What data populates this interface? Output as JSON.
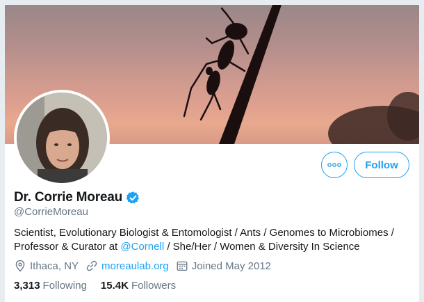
{
  "profile": {
    "name": "Dr. Corrie Moreau",
    "handle": "@CorrieMoreau",
    "verified": true,
    "bio_part1": "Scientist, Evolutionary Biologist & Entomologist / Ants / Genomes to Microbiomes / Professor & Curator at ",
    "bio_mention": "@Cornell",
    "bio_part2": " / She/Her / Women & Diversity In Science",
    "location": "Ithaca, NY",
    "website": "moreaulab.org",
    "joined": "Joined May 2012",
    "following_count": "3,313",
    "following_label": "Following",
    "followers_count": "15.4K",
    "followers_label": "Followers"
  },
  "actions": {
    "follow_label": "Follow",
    "more_label": "More"
  },
  "colors": {
    "accent": "#1da1f2",
    "secondary_text": "#657786",
    "primary_text": "#14171a"
  }
}
